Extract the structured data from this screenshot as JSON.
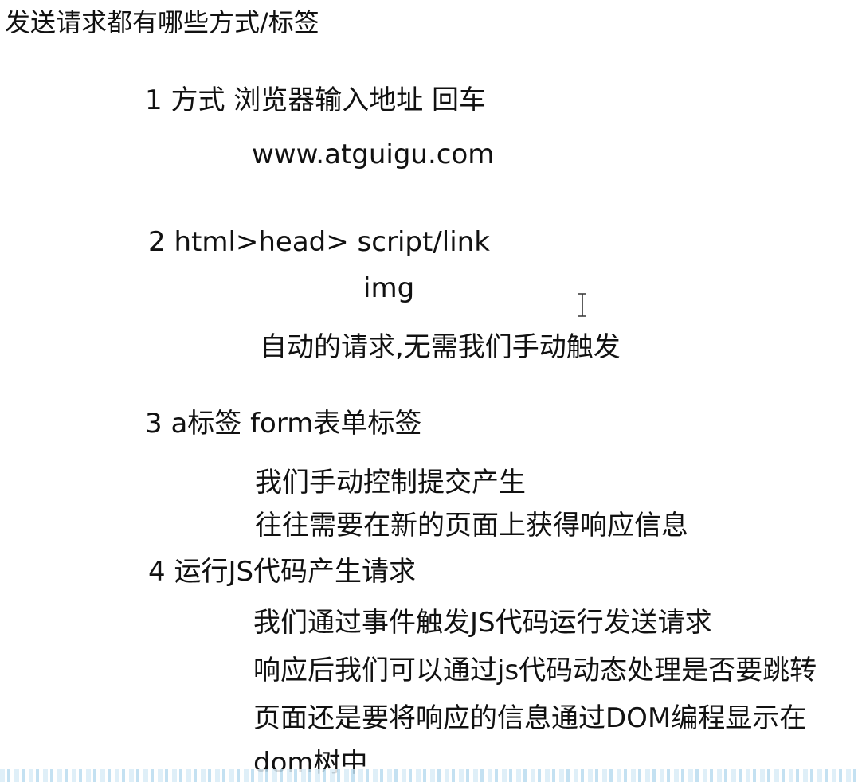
{
  "title": "发送请求都有哪些方式/标签",
  "items": [
    {
      "heading": "1 方式   浏览器输入地址 回车",
      "lines": [
        "www.atguigu.com"
      ]
    },
    {
      "heading": "2 html>head>  script/link",
      "lines": [
        "img",
        "自动的请求,无需我们手动触发"
      ]
    },
    {
      "heading": "3 a标签    form表单标签",
      "lines": [
        "我们手动控制提交产生",
        "往往需要在新的页面上获得响应信息"
      ]
    },
    {
      "heading": "4 运行JS代码产生请求",
      "lines": [
        "我们通过事件触发JS代码运行发送请求",
        "响应后我们可以通过js代码动态处理是否要跳转",
        "页面还是要将响应的信息通过DOM编程显示在",
        "dom树中"
      ]
    }
  ],
  "icons": {
    "cursor": "text-cursor-icon"
  }
}
